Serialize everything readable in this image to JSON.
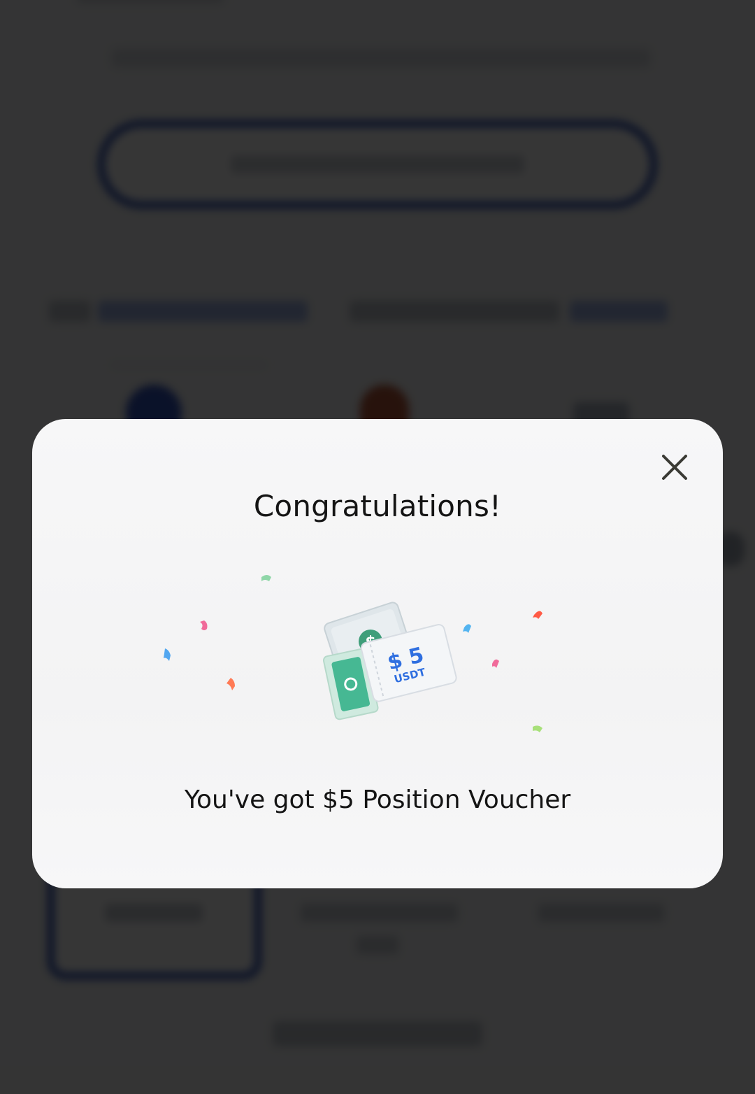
{
  "dialog": {
    "title": "Congratulations!",
    "message": "You've got $5 Position Voucher",
    "close_icon": "close-icon"
  },
  "voucher": {
    "amount": "$ 5",
    "unit": "USDT",
    "icon": "voucher-illustration",
    "accent_color": "#2f6fe0",
    "green_color": "#46b893"
  },
  "overlay": {
    "color": "#000000",
    "opacity": 0.79
  }
}
